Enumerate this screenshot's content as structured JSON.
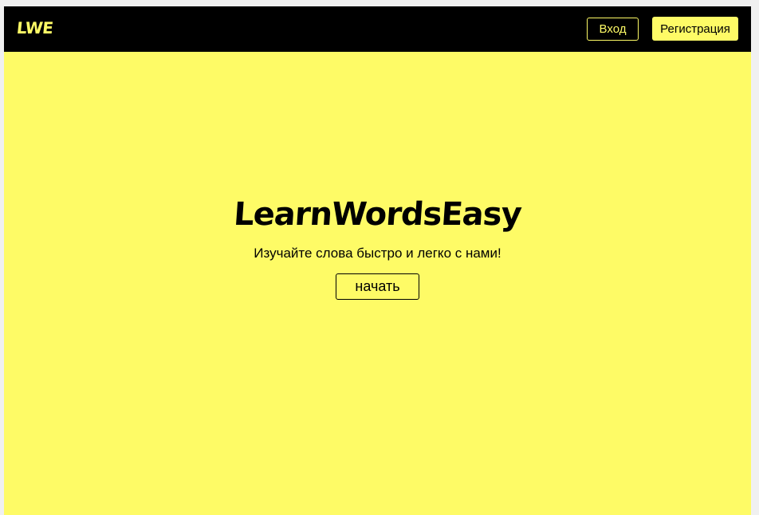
{
  "header": {
    "logo": "LWE",
    "login_label": "Вход",
    "register_label": "Регистрация"
  },
  "hero": {
    "title": "LearnWordsEasy",
    "subtitle": "Изучайте слова быстро и легко с нами!",
    "start_label": "начать"
  },
  "colors": {
    "background": "#fefb66",
    "navbar": "#000000",
    "accent": "#fefb66",
    "text": "#000000"
  }
}
